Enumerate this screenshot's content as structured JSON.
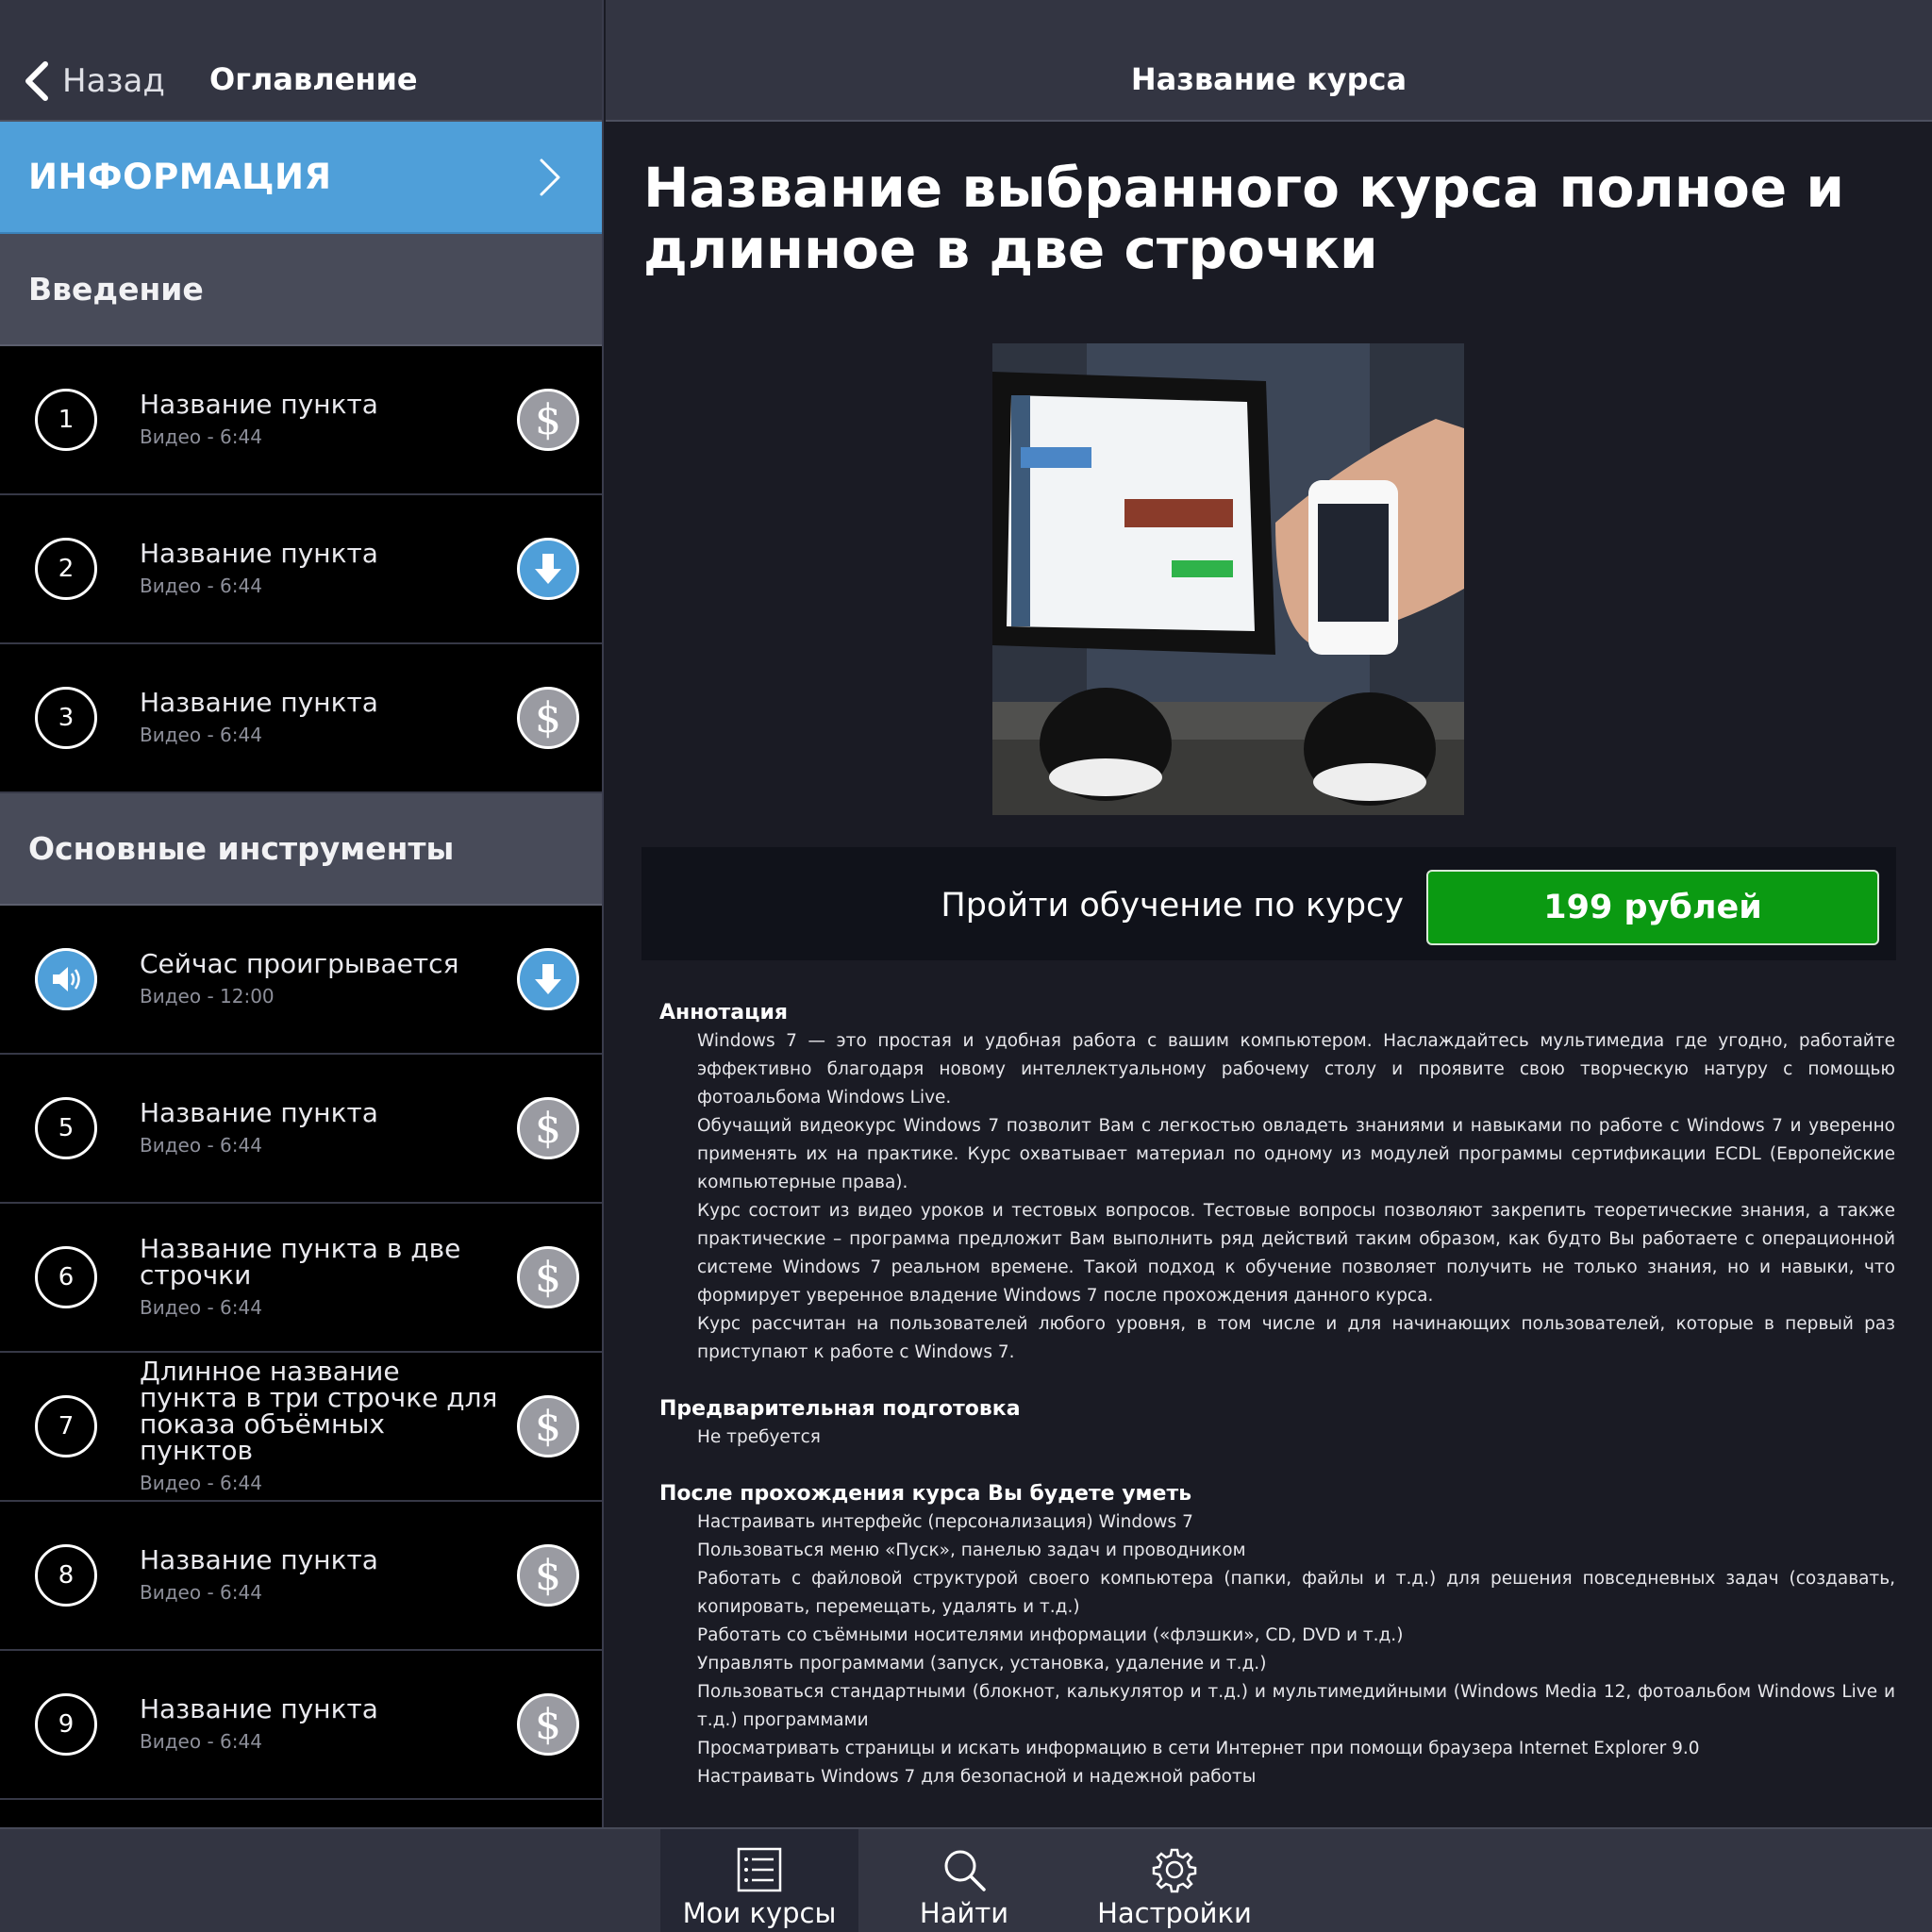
{
  "left_header": {
    "back_label": "Назад",
    "title": "Оглавление"
  },
  "info": {
    "label": "ИНФОРМАЦИЯ"
  },
  "sections": [
    {
      "title": "Введение",
      "items": [
        {
          "num": "1",
          "title": "Название пункта",
          "sub": "Видео - 6:44",
          "action": "dollar-icon"
        },
        {
          "num": "2",
          "title": "Название пункта",
          "sub": "Видео - 6:44",
          "action": "download-icon"
        },
        {
          "num": "3",
          "title": "Название пункта",
          "sub": "Видео - 6:44",
          "action": "dollar-icon"
        }
      ]
    },
    {
      "title": "Основные инструменты",
      "items": [
        {
          "num": "",
          "title": "Сейчас проигрывается",
          "sub": "Видео - 12:00",
          "action": "download-icon",
          "playing": true
        },
        {
          "num": "5",
          "title": "Название пункта",
          "sub": "Видео - 6:44",
          "action": "dollar-icon"
        },
        {
          "num": "6",
          "title": "Название пункта в две строчки",
          "sub": "Видео - 6:44",
          "action": "dollar-icon"
        },
        {
          "num": "7",
          "title": "Длинное название пункта в три строчке для показа объёмных пунктов",
          "sub": "Видео - 6:44",
          "action": "dollar-icon"
        },
        {
          "num": "8",
          "title": "Название пункта",
          "sub": "Видео - 6:44",
          "action": "dollar-icon"
        },
        {
          "num": "9",
          "title": "Название пункта",
          "sub": "Видео - 6:44",
          "action": "dollar-icon"
        }
      ]
    }
  ],
  "right_header": {
    "title": "Название курса"
  },
  "course": {
    "title": "Название выбранного курса полное и длинное в две строчки",
    "buy_text": "Пройти обучение по курсу",
    "price": "199 рублей"
  },
  "details": [
    {
      "heading": "Аннотация",
      "paragraphs": [
        "Windows 7 — это простая и удобная работа с вашим компьютером. Наслаждайтесь мультимедиа где угодно, работайте эффективно благодаря новому интеллектуальному рабочему столу и проявите свою творческую натуру с помощью фотоальбома Windows Live.",
        "Обучащий видеокурс Windows 7 позволит Вам с легкостью овладеть знаниями и навыками по работе с Windows 7 и уверенно применять их на практике. Курс охватывает материал по одному из модулей программы сертификации ECDL (Европейские компьютерные права).",
        "Курс состоит из видео уроков и тестовых вопросов. Тестовые вопросы позволяют закрепить теоретические знания, а также практические – программа предложит Вам выполнить ряд действий таким образом, как будто Вы работаете с операционной системе Windows 7 реальном времене. Такой подход к обучение позволяет получить не только знания, но и навыки, что формирует уверенное владение Windows 7 после прохождения данного курса.",
        "Курс рассчитан на пользователей любого уровня, в том числе и для начинающих пользователей, которые в первый раз приступают к работе с Windows 7."
      ]
    },
    {
      "heading": "Предварительная подготовка",
      "paragraphs": [
        "Не требуется"
      ]
    },
    {
      "heading": "После прохождения курса Вы будете уметь",
      "paragraphs": [
        "Настраивать интерфейс (персонализация) Windows 7",
        "Пользоваться меню «Пуск», панелью задач и проводником",
        "Работать с файловой структурой своего компьютера (папки, файлы и т.д.) для решения повседневных задач (создавать, копировать, перемещать, удалять и т.д.)",
        "Работать со съёмными носителями информации («флэшки», CD, DVD и т.д.)",
        "Управлять программами (запуск, установка, удаление и т.д.)",
        "Пользоваться стандартными (блокнот, калькулятор и т.д.) и мультимедийными (Windows Media 12, фотоальбом Windows Live и т.д.) программами",
        "Просматривать страницы и искать информацию в сети Интернет при помощи браузера Internet Explorer 9.0",
        "Настраивать Windows 7 для безопасной и надежной работы"
      ]
    }
  ],
  "tabs": [
    {
      "id": "courses",
      "label": "Мои курсы",
      "icon": "list-icon"
    },
    {
      "id": "find",
      "label": "Найти",
      "icon": "search-icon"
    },
    {
      "id": "settings",
      "label": "Настройки",
      "icon": "gear-icon"
    }
  ],
  "colors": {
    "accent": "#4f9fd9",
    "buy": "#0b9a12",
    "header": "#333542",
    "section": "#484b59"
  }
}
